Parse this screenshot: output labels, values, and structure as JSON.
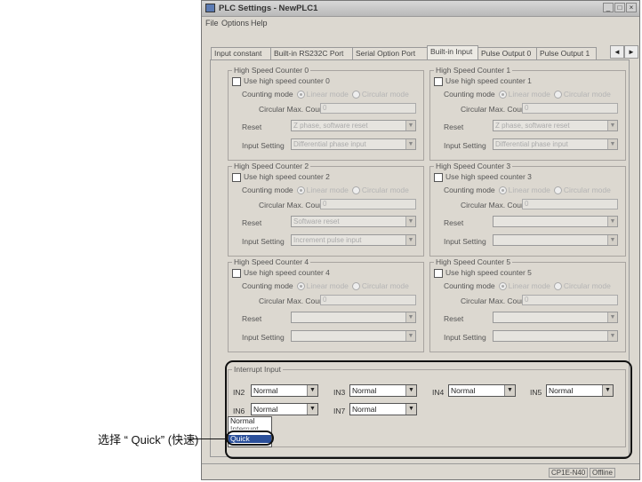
{
  "window": {
    "title": "PLC Settings - NewPLC1",
    "buttons": [
      "_",
      "□",
      "×"
    ]
  },
  "menu": [
    "File",
    "Options",
    "Help"
  ],
  "tabs": [
    {
      "label": "Input constant",
      "active": false
    },
    {
      "label": "Built-in RS232C Port",
      "active": false
    },
    {
      "label": "Serial Option Port",
      "active": false
    },
    {
      "label": "Built-in Input",
      "active": true
    },
    {
      "label": "Pulse Output 0",
      "active": false
    },
    {
      "label": "Pulse Output 1",
      "active": false
    }
  ],
  "tab_scroll": [
    "◄",
    "►"
  ],
  "labels": {
    "counting_mode": "Counting mode",
    "linear_mode": "Linear mode",
    "circular_mode": "Circular mode",
    "circular_max_count": "Circular Max. Count",
    "reset": "Reset",
    "input_setting": "Input Setting"
  },
  "counters": [
    {
      "title": "High Speed Counter 0",
      "use_label": "Use high speed counter 0",
      "max_count": "0",
      "reset": "Z phase, software reset",
      "input_setting": "Differential phase input"
    },
    {
      "title": "High Speed Counter 1",
      "use_label": "Use high speed counter 1",
      "max_count": "0",
      "reset": "Z phase, software reset",
      "input_setting": "Differential phase input"
    },
    {
      "title": "High Speed Counter 2",
      "use_label": "Use high speed counter 2",
      "max_count": "0",
      "reset": "Software reset",
      "input_setting": "Increment pulse input"
    },
    {
      "title": "High Speed Counter 3",
      "use_label": "Use high speed counter 3",
      "max_count": "0",
      "reset": "",
      "input_setting": ""
    },
    {
      "title": "High Speed Counter 4",
      "use_label": "Use high speed counter 4",
      "max_count": "0",
      "reset": "",
      "input_setting": ""
    },
    {
      "title": "High Speed Counter 5",
      "use_label": "Use high speed counter 5",
      "max_count": "0",
      "reset": "",
      "input_setting": ""
    }
  ],
  "interrupt": {
    "title": "Interrupt Input",
    "inputs": [
      {
        "label": "IN2",
        "value": "Normal"
      },
      {
        "label": "IN3",
        "value": "Normal"
      },
      {
        "label": "IN4",
        "value": "Normal"
      },
      {
        "label": "IN5",
        "value": "Normal"
      },
      {
        "label": "IN6",
        "value": "Normal"
      },
      {
        "label": "IN7",
        "value": "Normal"
      }
    ],
    "dropdown_options": [
      "Normal",
      "Interrupt",
      "Quick"
    ],
    "dropdown_selected": "Quick"
  },
  "status": [
    "CP1E-N40",
    "Offline"
  ],
  "callout": "选择 “ Quick” (快速)"
}
